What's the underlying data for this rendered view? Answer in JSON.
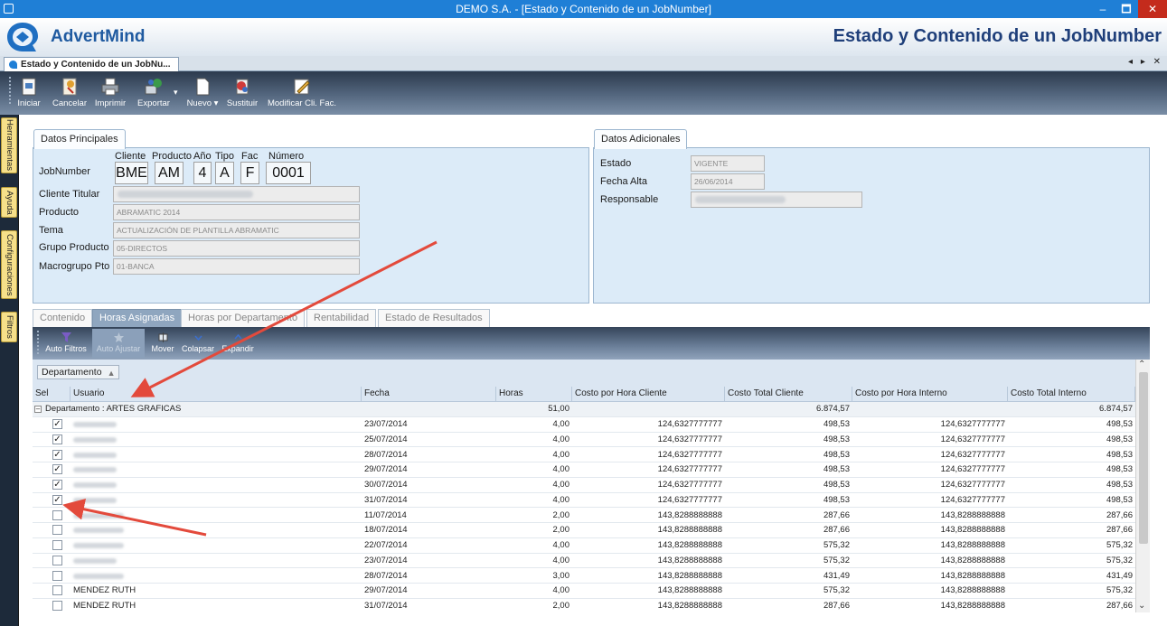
{
  "window": {
    "title": "DEMO S.A. - [Estado y Contenido de un JobNumber]",
    "min": "–",
    "max": "🗖",
    "close": "✕"
  },
  "brand": {
    "name": "AdvertMind",
    "page_title": "Estado y Contenido de un JobNumber"
  },
  "doc_tab": {
    "label": "Estado y Contenido de un JobNu...",
    "controls": "◂ ▸ ✕"
  },
  "toolbar": [
    {
      "label": "Iniciar",
      "icon": "new-document-icon"
    },
    {
      "label": "Cancelar",
      "icon": "cancel-icon"
    },
    {
      "label": "Imprimir",
      "icon": "printer-icon"
    },
    {
      "label": "Exportar",
      "icon": "export-icon"
    },
    {
      "label": "Nuevo ▾",
      "icon": "document-icon"
    },
    {
      "label": "Sustituir",
      "icon": "replace-icon"
    },
    {
      "label": "Modificar Cli. Fac.",
      "icon": "edit-icon"
    }
  ],
  "sidebar_tabs": [
    "Herramientas",
    "Ayuda",
    "Configuraciones",
    "Filtros"
  ],
  "datos_principales": {
    "title": "Datos Principales",
    "jobnumber_label": "JobNumber",
    "sublabels": [
      "Cliente",
      "Producto",
      "Año",
      "Tipo",
      "Fac",
      "Número"
    ],
    "jobnumber_parts": [
      "BME",
      "AM",
      "4",
      "A",
      "F",
      "0001"
    ],
    "fields": [
      {
        "label": "Cliente Titular",
        "value": ""
      },
      {
        "label": "Producto",
        "value": "ABRAMATIC 2014"
      },
      {
        "label": "Tema",
        "value": "ACTUALIZACIÓN DE PLANTILLA ABRAMATIC"
      },
      {
        "label": "Grupo Producto",
        "value": "05-DIRECTOS"
      },
      {
        "label": "Macrogrupo Pto",
        "value": "01-BANCA"
      }
    ]
  },
  "datos_adicionales": {
    "title": "Datos Adicionales",
    "fields": [
      {
        "label": "Estado",
        "value": "VIGENTE"
      },
      {
        "label": "Fecha Alta",
        "value": "26/06/2014"
      },
      {
        "label": "Responsable",
        "value": ""
      }
    ]
  },
  "content_tabs": [
    "Contenido",
    "Horas Asignadas",
    "Horas por Departamento",
    "Rentabilidad",
    "Estado de Resultados"
  ],
  "active_tab": 1,
  "grid_toolbar": [
    "Auto Filtros",
    "Auto Ajustar",
    "Mover",
    "Colapsar",
    "Expandir"
  ],
  "group_chip": {
    "label": "Departamento",
    "sort": "▲"
  },
  "columns": [
    "Sel",
    "Usuario",
    "Fecha",
    "Horas",
    "Costo por Hora Cliente",
    "Costo Total Cliente",
    "Costo por Hora Interno",
    "Costo Total Interno"
  ],
  "group_row": {
    "label": "Departamento : ARTES GRAFICAS",
    "expander": "–",
    "horas": "51,00",
    "costo_total_cliente": "6.874,57",
    "costo_total_interno": "6.874,57"
  },
  "rows": [
    {
      "checked": true,
      "usuario": "",
      "fecha": "23/07/2014",
      "horas": "4,00",
      "cph_cliente": "124,6327777777",
      "ct_cliente": "498,53",
      "cph_interno": "124,6327777777",
      "ct_interno": "498,53"
    },
    {
      "checked": true,
      "usuario": "",
      "fecha": "25/07/2014",
      "horas": "4,00",
      "cph_cliente": "124,6327777777",
      "ct_cliente": "498,53",
      "cph_interno": "124,6327777777",
      "ct_interno": "498,53"
    },
    {
      "checked": true,
      "usuario": "",
      "fecha": "28/07/2014",
      "horas": "4,00",
      "cph_cliente": "124,6327777777",
      "ct_cliente": "498,53",
      "cph_interno": "124,6327777777",
      "ct_interno": "498,53"
    },
    {
      "checked": true,
      "usuario": "",
      "fecha": "29/07/2014",
      "horas": "4,00",
      "cph_cliente": "124,6327777777",
      "ct_cliente": "498,53",
      "cph_interno": "124,6327777777",
      "ct_interno": "498,53"
    },
    {
      "checked": true,
      "usuario": "",
      "fecha": "30/07/2014",
      "horas": "4,00",
      "cph_cliente": "124,6327777777",
      "ct_cliente": "498,53",
      "cph_interno": "124,6327777777",
      "ct_interno": "498,53"
    },
    {
      "checked": true,
      "usuario": "",
      "fecha": "31/07/2014",
      "horas": "4,00",
      "cph_cliente": "124,6327777777",
      "ct_cliente": "498,53",
      "cph_interno": "124,6327777777",
      "ct_interno": "498,53"
    },
    {
      "checked": false,
      "usuario": "",
      "fecha": "11/07/2014",
      "horas": "2,00",
      "cph_cliente": "143,8288888888",
      "ct_cliente": "287,66",
      "cph_interno": "143,8288888888",
      "ct_interno": "287,66"
    },
    {
      "checked": false,
      "usuario": "",
      "fecha": "18/07/2014",
      "horas": "2,00",
      "cph_cliente": "143,8288888888",
      "ct_cliente": "287,66",
      "cph_interno": "143,8288888888",
      "ct_interno": "287,66"
    },
    {
      "checked": false,
      "usuario": "",
      "fecha": "22/07/2014",
      "horas": "4,00",
      "cph_cliente": "143,8288888888",
      "ct_cliente": "575,32",
      "cph_interno": "143,8288888888",
      "ct_interno": "575,32"
    },
    {
      "checked": false,
      "usuario": "",
      "fecha": "23/07/2014",
      "horas": "4,00",
      "cph_cliente": "143,8288888888",
      "ct_cliente": "575,32",
      "cph_interno": "143,8288888888",
      "ct_interno": "575,32"
    },
    {
      "checked": false,
      "usuario": "",
      "fecha": "28/07/2014",
      "horas": "3,00",
      "cph_cliente": "143,8288888888",
      "ct_cliente": "431,49",
      "cph_interno": "143,8288888888",
      "ct_interno": "431,49"
    },
    {
      "checked": false,
      "usuario": "MENDEZ RUTH",
      "fecha": "29/07/2014",
      "horas": "4,00",
      "cph_cliente": "143,8288888888",
      "ct_cliente": "575,32",
      "cph_interno": "143,8288888888",
      "ct_interno": "575,32"
    },
    {
      "checked": false,
      "usuario": "MENDEZ RUTH",
      "fecha": "31/07/2014",
      "horas": "2,00",
      "cph_cliente": "143,8288888888",
      "ct_cliente": "287,66",
      "cph_interno": "143,8288888888",
      "ct_interno": "287,66"
    }
  ],
  "scroll": {
    "up": "⌃",
    "down": "⌄"
  },
  "check_glyph": "✓",
  "annotation_color": "#e34a3c"
}
